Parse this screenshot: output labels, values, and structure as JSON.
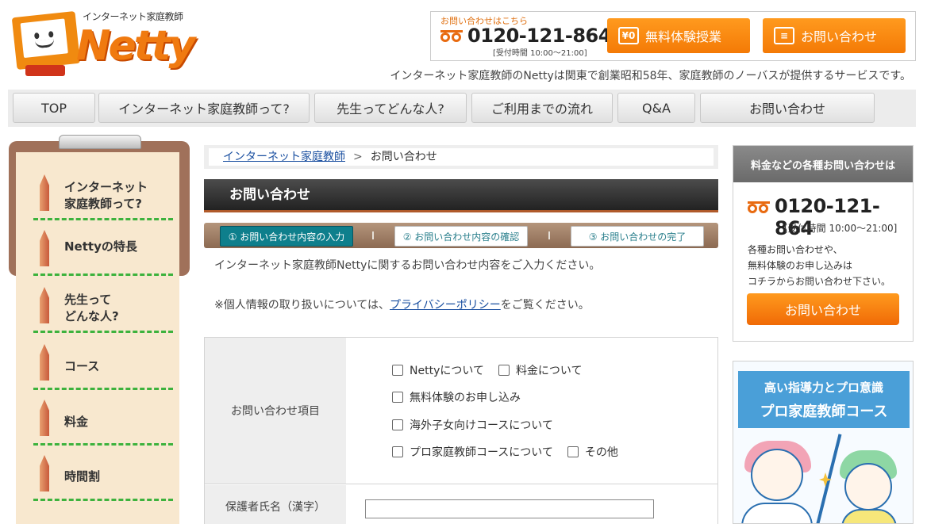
{
  "logo": {
    "caption": "インターネット家庭教師",
    "word": "Netty"
  },
  "header": {
    "tel_note": "お問い合わせはこちら",
    "tel_number": "0120-121-864",
    "tel_hours": "[受付時間 10:00〜21:00]",
    "trial_button": "無料体験授業",
    "trial_icon_text": "¥0",
    "contact_button": "お問い合わせ",
    "tagline": "インターネット家庭教師のNettyは関東で創業昭和58年、家庭教師のノーバスが提供するサービスです。"
  },
  "nav": [
    {
      "label": "TOP"
    },
    {
      "label": "インターネット家庭教師って?"
    },
    {
      "label": "先生ってどんな人?"
    },
    {
      "label": "ご利用までの流れ"
    },
    {
      "label": "Q&A"
    },
    {
      "label": "お問い合わせ"
    }
  ],
  "left_nav": [
    {
      "line1": "インターネット",
      "line2": "家庭教師って?"
    },
    {
      "line1": "Nettyの特長",
      "line2": ""
    },
    {
      "line1": "先生って",
      "line2": "どんな人?"
    },
    {
      "line1": "コース",
      "line2": ""
    },
    {
      "line1": "料金",
      "line2": ""
    },
    {
      "line1": "時間割",
      "line2": ""
    }
  ],
  "breadcrumb": {
    "home": "インターネット家庭教師",
    "separator": ">",
    "current": "お問い合わせ"
  },
  "page_title": "お問い合わせ",
  "steps": [
    "① お問い合わせ内容の入力",
    "② お問い合わせ内容の確認",
    "③ お問い合わせの完了"
  ],
  "intro": {
    "line1": "インターネット家庭教師Nettyに関するお問い合わせ内容をご入力ください。",
    "line2_prefix": "※個人情報の取り扱いについては、",
    "line2_link": "プライバシーポリシー",
    "line2_suffix": "をご覧ください。"
  },
  "form": {
    "inquiry_label": "お問い合わせ項目",
    "options": {
      "about_netty": "Nettyについて",
      "about_fee": "料金について",
      "trial": "無料体験のお申し込み",
      "overseas": "海外子女向けコースについて",
      "pro_course": "プロ家庭教師コースについて",
      "other": "その他"
    },
    "guardian_name_label": "保護者氏名（漢字）",
    "guardian_name_value": ""
  },
  "right_box": {
    "header": "料金などの各種お問い合わせは",
    "tel_number": "0120-121-864",
    "tel_hours": "[受付時間 10:00〜21:00]",
    "text_line1": "各種お問い合わせや、",
    "text_line2": "無料体験のお申し込みは",
    "text_line3": "コチラからお問い合わせ下さい。",
    "button": "お問い合わせ"
  },
  "banner": {
    "line1": "高い指導力とプロ意識",
    "line2": "プロ家庭教師コース"
  },
  "colors": {
    "accent_orange": "#f47a06",
    "teal": "#0e7f8c",
    "link_blue": "#1a4fa0",
    "pencil_dash_green": "#3db23d"
  }
}
